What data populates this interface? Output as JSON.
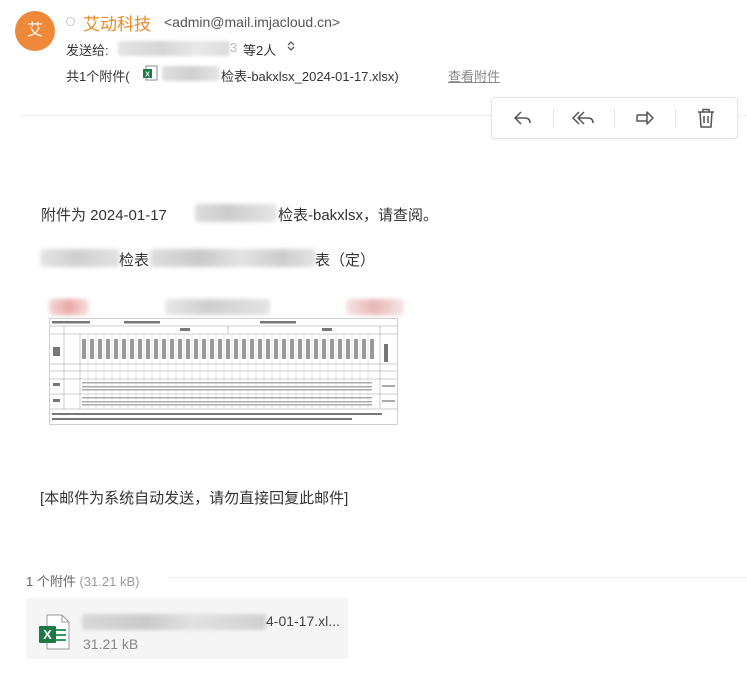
{
  "header": {
    "avatar_letter": "艾",
    "sender_name": "艾动科技",
    "sender_email": "<admin@mail.imjacloud.cn>",
    "recipients_label": "发送给:",
    "recipients_visible_digit": "3",
    "recipients_count": "等2人",
    "recipients_chevron": "⌃⌄",
    "attachments_prefix": "共1个附件(",
    "attachment_name_visible": "检表-bakxlsx_2024-01-17.xlsx)",
    "view_attachments": "查看附件"
  },
  "toolbar": {
    "icons": [
      "reply-icon",
      "reply-all-icon",
      "forward-icon",
      "delete-icon"
    ]
  },
  "body": {
    "line1_prefix": "附件为 2024-01-17",
    "line1_suffix": "检表-bakxlsx，请查阅。",
    "line2_part1": "检表",
    "line2_part2": "表（定）",
    "footer_note": "[本邮件为系统自动发送，请勿直接回复此邮件]"
  },
  "attachments": {
    "count_label": "1 个附件",
    "total_size": "(31.21 kB)",
    "file_name_visible": "4-01-17.xl...",
    "file_size": "31.21 kB"
  },
  "colors": {
    "accent": "#f08a24",
    "avatar_bg": "#f0883a",
    "excel_green": "#1d7a45"
  }
}
